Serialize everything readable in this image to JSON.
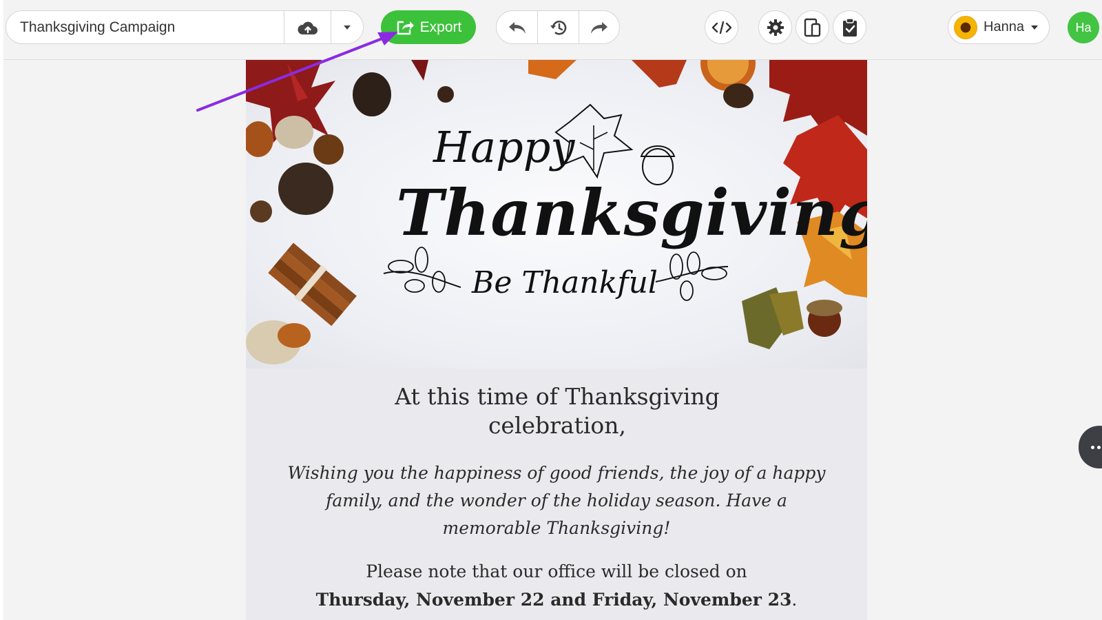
{
  "toolbar": {
    "campaign_name": "Thanksgiving Campaign",
    "export_label": "Export",
    "user_name": "Hanna",
    "user_initials": "Ha",
    "icons": {
      "save": "cloud-upload-icon",
      "menu": "caret-down-icon",
      "export": "share-icon",
      "undo": "undo-icon",
      "history": "history-icon",
      "redo": "redo-icon",
      "code": "code-icon",
      "settings": "gear-icon",
      "preview": "device-preview-icon",
      "tasks": "clipboard-check-icon"
    }
  },
  "email": {
    "hero": {
      "script_happy": "Happy",
      "script_title": "Thanksgiving",
      "script_sub": "Be Thankful"
    },
    "heading": "At this time of Thanksgiving celebration,",
    "wish": "Wishing you the happiness of good friends, the joy of a happy family, and the wonder of the holiday season. Have a memorable Thanksgiving!",
    "note_prefix": "Please note that our office will be closed on",
    "note_dates": "Thursday, November 22 and Friday, November 23",
    "note_suffix": "."
  },
  "colors": {
    "accent_green": "#3cc13b",
    "annotation_arrow": "#8a2be2",
    "more_button": "#3e3f44"
  }
}
